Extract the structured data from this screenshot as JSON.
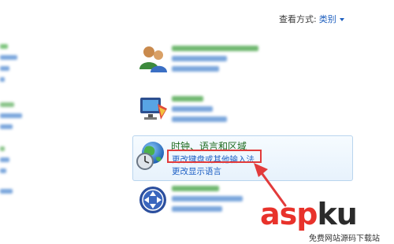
{
  "toolbar": {
    "view_by_label": "查看方式:",
    "view_by_value": "类别"
  },
  "categories": {
    "clock_language_region": {
      "title": "时钟、语言和区域",
      "links": [
        "更改键盘或其他输入法",
        "更改显示语言"
      ]
    }
  },
  "watermark": {
    "brand_red": "asp",
    "brand_dark": "ku",
    "tagline": "免费网站源码下载站"
  },
  "colors": {
    "link": "#1d5fc4",
    "category_title": "#1d6a1d",
    "highlight_box": "#e23b3b",
    "arrow": "#e23b3b",
    "panel_bg": "#e7f2fc"
  }
}
